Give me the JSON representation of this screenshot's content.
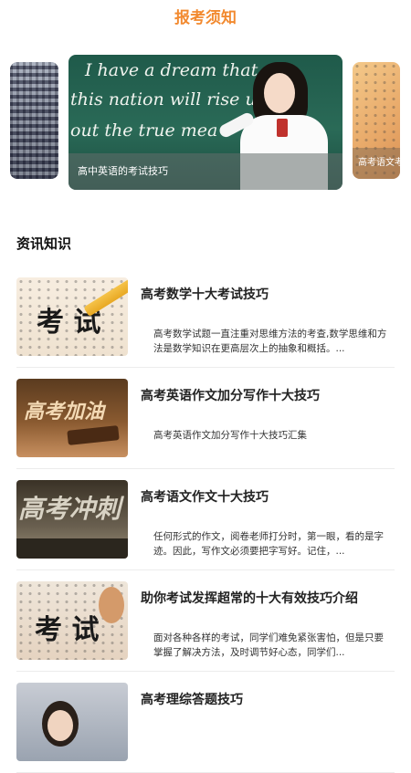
{
  "header": {
    "title": "报考须知"
  },
  "carousel": {
    "main_caption": "高中英语的考试技巧",
    "right_caption": "高考语文考",
    "chalk": [
      "I  have a dream that",
      "this  nation will  rise up",
      "out  the  true  mea"
    ]
  },
  "section": {
    "title": "资讯知识"
  },
  "articles": [
    {
      "title": "高考数学十大考试技巧",
      "desc": "高考数学试题一直注重对思维方法的考查,数学思维和方法是数学知识在更高层次上的抽象和概括。...",
      "thumb_text": "考 试"
    },
    {
      "title": "高考英语作文加分写作十大技巧",
      "desc": "高考英语作文加分写作十大技巧汇集",
      "thumb_text": "高考加油"
    },
    {
      "title": "高考语文作文十大技巧",
      "desc": "任何形式的作文，阅卷老师打分时，第一眼，看的是字迹。因此，写作文必须要把字写好。记住，...",
      "thumb_text": "高考冲刺"
    },
    {
      "title": "助你考试发挥超常的十大有效技巧介绍",
      "desc": "面对各种各样的考试，同学们难免紧张害怕，但是只要掌握了解决方法，及时调节好心态，同学们...",
      "thumb_text": "考 试"
    },
    {
      "title": "高考理综答题技巧",
      "desc": "",
      "thumb_text": ""
    }
  ]
}
